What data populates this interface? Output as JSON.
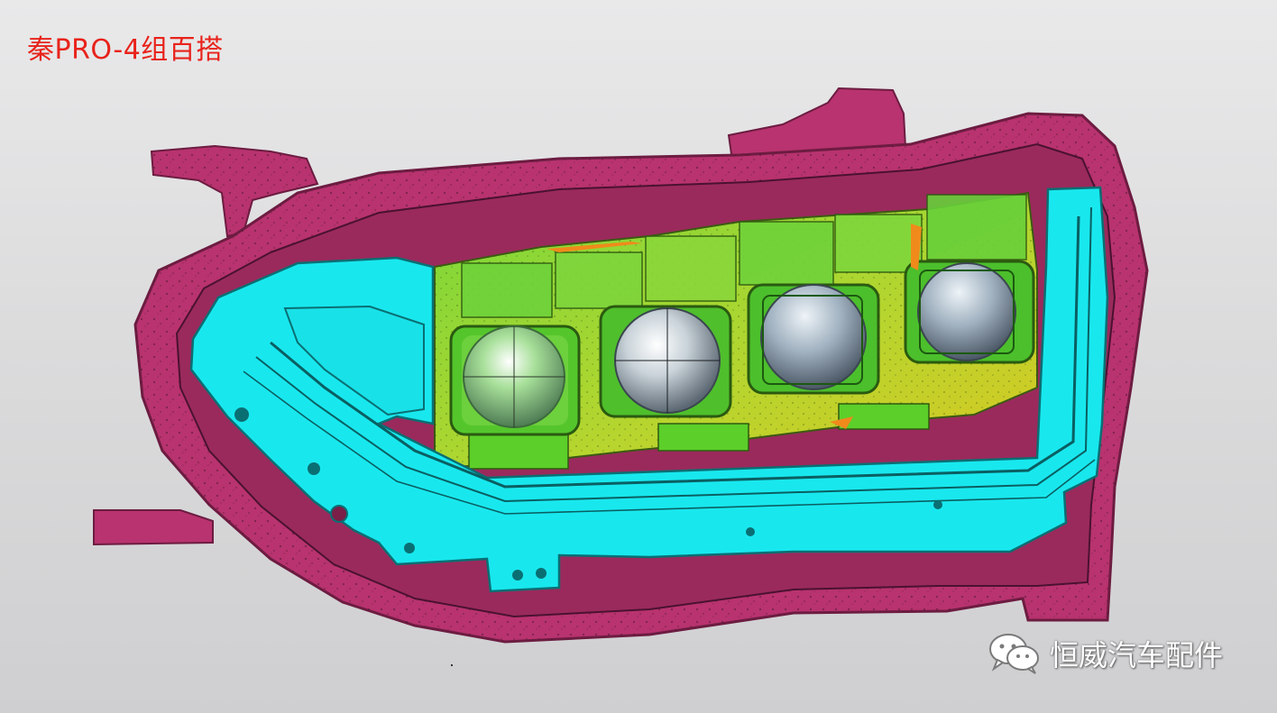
{
  "title": "秦PRO-4组百搭",
  "watermark": {
    "text": "恒威汽车配件",
    "icon": "wechat-icon"
  },
  "colors": {
    "housing": "#b8336f",
    "housing_dark": "#7a1f48",
    "bezel": "#15e8ec",
    "module_green": "#5ccf2a",
    "module_yellow": "#c9d32a",
    "lens_silver": "#b9c2ca",
    "title_red": "#e8231b"
  },
  "parts": {
    "housing": "housing",
    "bezel": "bezel",
    "modules": [
      "module-1",
      "module-2",
      "module-3",
      "module-4"
    ]
  }
}
